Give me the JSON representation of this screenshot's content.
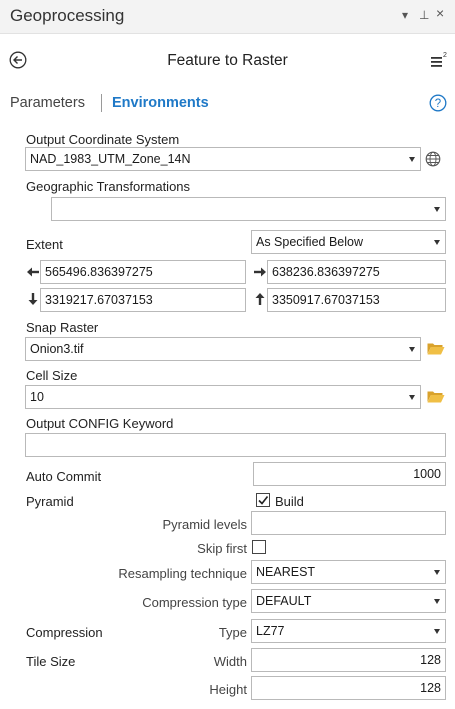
{
  "pane": {
    "title": "Geoprocessing",
    "pin_glyph": "▾ ⊥ ×"
  },
  "tool": {
    "title": "Feature to Raster"
  },
  "tabs": {
    "parameters": "Parameters",
    "environments": "Environments"
  },
  "env": {
    "output_cs": {
      "label": "Output Coordinate System",
      "value": "NAD_1983_UTM_Zone_14N"
    },
    "geo_transform": {
      "label": "Geographic Transformations",
      "value": ""
    },
    "extent": {
      "label": "Extent",
      "mode": "As Specified Below",
      "left": "565496.836397275",
      "right": "638236.836397275",
      "bottom": "3319217.67037153",
      "top": "3350917.67037153"
    },
    "snap_raster": {
      "label": "Snap Raster",
      "value": "Onion3.tif"
    },
    "cell_size": {
      "label": "Cell Size",
      "value": "10"
    },
    "config_keyword": {
      "label": "Output CONFIG Keyword",
      "value": ""
    },
    "auto_commit": {
      "label": "Auto Commit",
      "value": "1000"
    },
    "pyramid": {
      "label": "Pyramid",
      "build_label": "Build",
      "build_checked": true,
      "levels_label": "Pyramid levels",
      "levels_value": "",
      "skip_first_label": "Skip first",
      "skip_first_checked": false,
      "resampling_label": "Resampling technique",
      "resampling_value": "NEAREST",
      "compression_type_label": "Compression type",
      "compression_type_value": "DEFAULT"
    },
    "compression": {
      "label": "Compression",
      "type_label": "Type",
      "type_value": "LZ77"
    },
    "tile_size": {
      "label": "Tile Size",
      "width_label": "Width",
      "width_value": "128",
      "height_label": "Height",
      "height_value": "128"
    }
  },
  "colors": {
    "accent": "#1f79c7",
    "folder": "#e8b33c",
    "pane_bg": "#f3f3f3"
  }
}
